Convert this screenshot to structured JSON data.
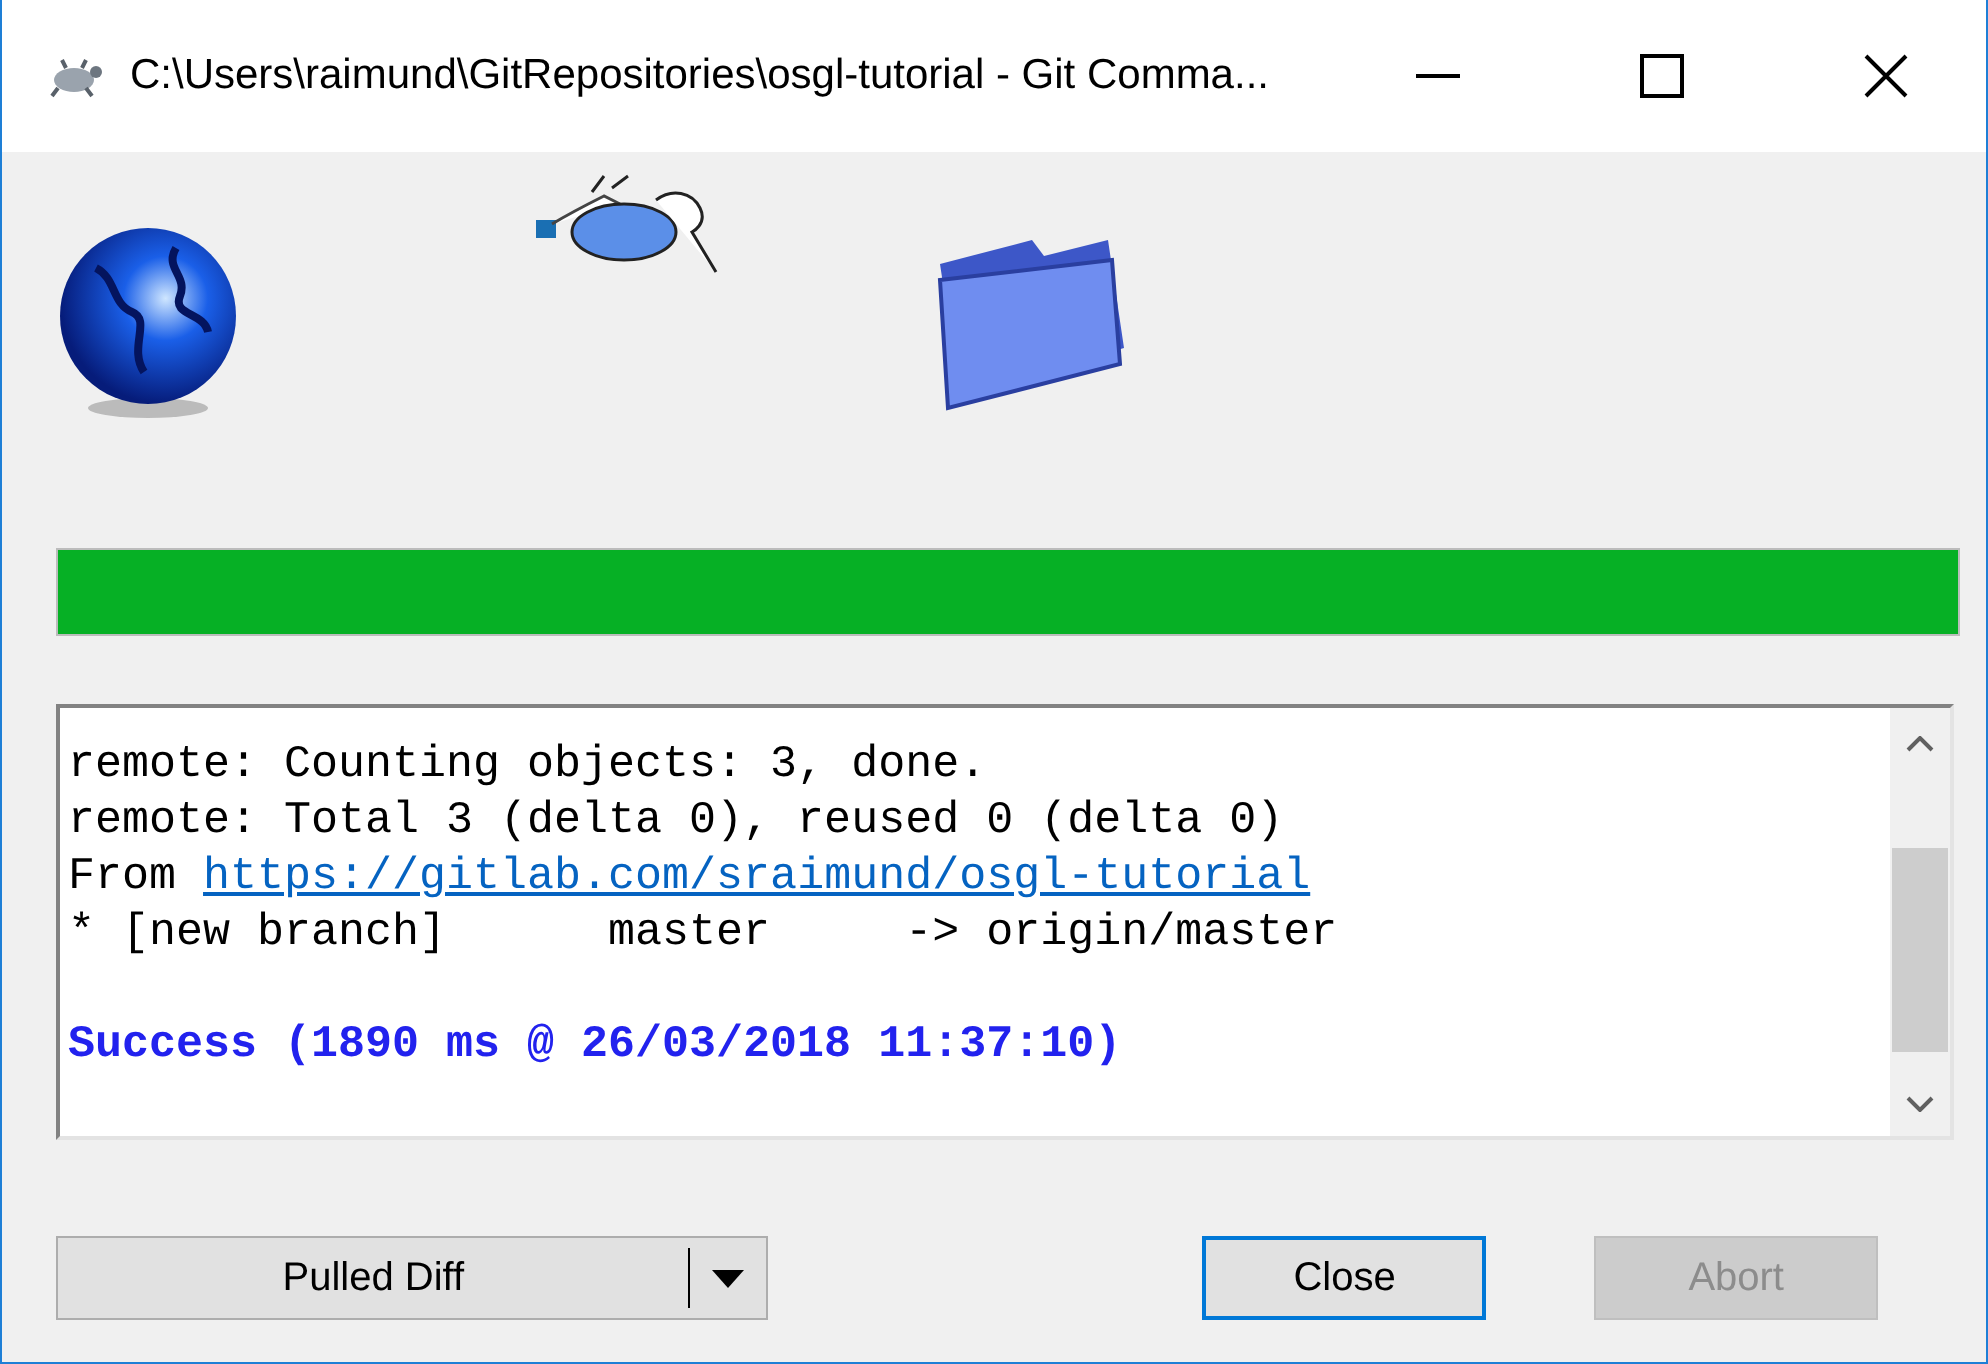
{
  "window": {
    "title": "C:\\Users\\raimund\\GitRepositories\\osgl-tutorial - Git Comma..."
  },
  "progress": {
    "level": 1.0
  },
  "log": {
    "lines": [
      {
        "kind": "text",
        "text": "remote: Counting objects: 3, done."
      },
      {
        "kind": "text",
        "text": "remote: Total 3 (delta 0), reused 0 (delta 0)"
      },
      {
        "kind": "link",
        "prefix": "From",
        "url": "https://gitlab.com/sraimund/osgl-tutorial"
      },
      {
        "kind": "text",
        "text": "* [new branch]      master     -> origin/master"
      },
      {
        "kind": "success",
        "text": "Success (1890 ms @ 26/03/2018 11:37:10)"
      }
    ]
  },
  "buttons": [
    {
      "kind": "split",
      "label": "Pulled Diff",
      "disabled": false,
      "focused": false
    },
    {
      "kind": "push",
      "label": "Close",
      "disabled": false,
      "focused": true
    },
    {
      "kind": "push",
      "label": "Abort",
      "disabled": true,
      "focused": false
    }
  ]
}
